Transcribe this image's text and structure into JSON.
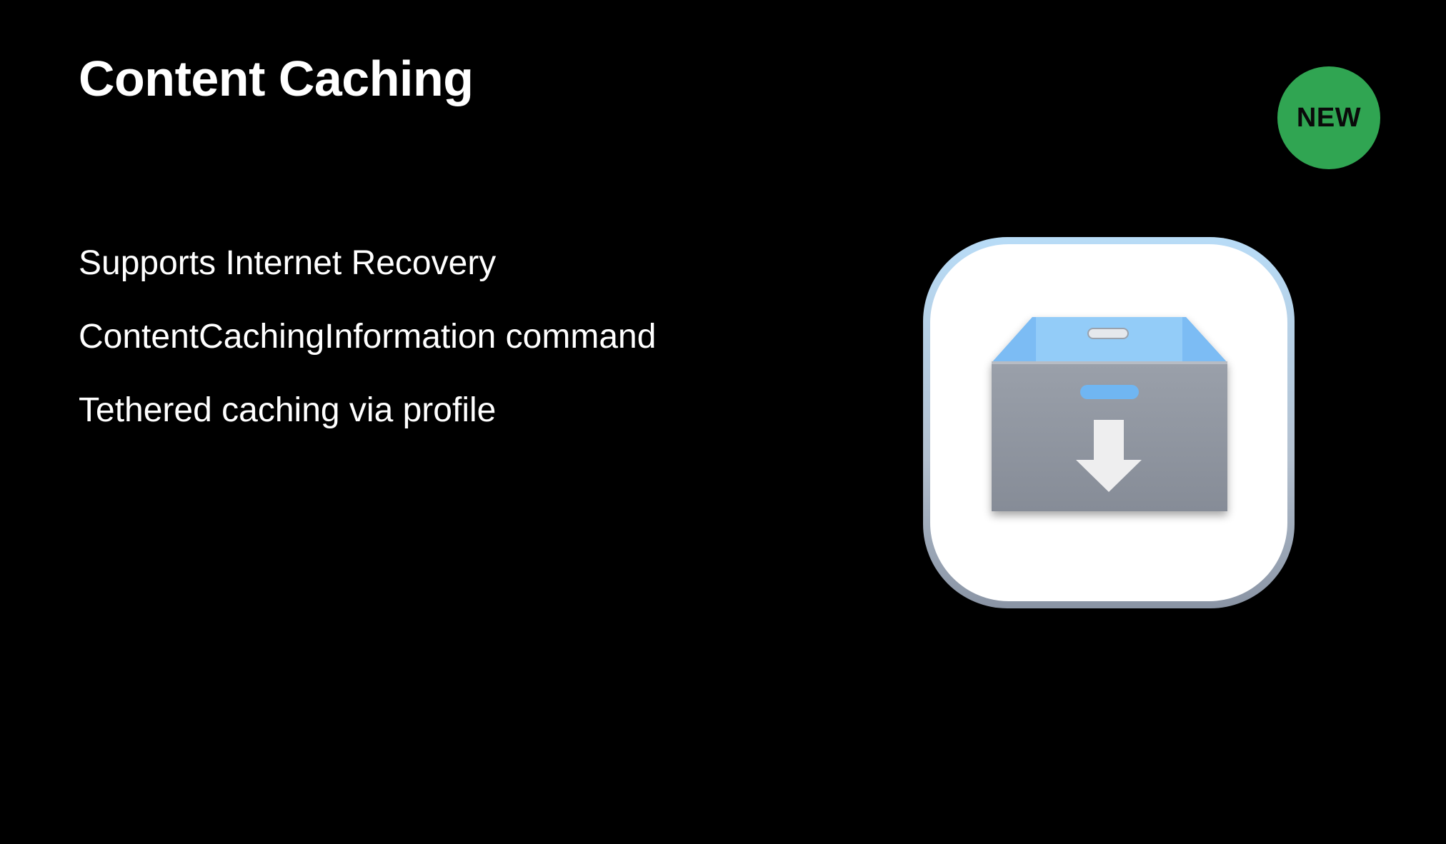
{
  "slide": {
    "title": "Content Caching",
    "badge": "NEW",
    "bullets": [
      "Supports Internet Recovery",
      "ContentCachingInformation command",
      "Tethered caching via profile"
    ],
    "icon": "content-caching-box-download-icon"
  },
  "colors": {
    "background": "#000000",
    "text": "#ffffff",
    "badge": "#30a552",
    "icon_box": "#8e949f",
    "icon_box_inside": "#6fb6f2"
  }
}
